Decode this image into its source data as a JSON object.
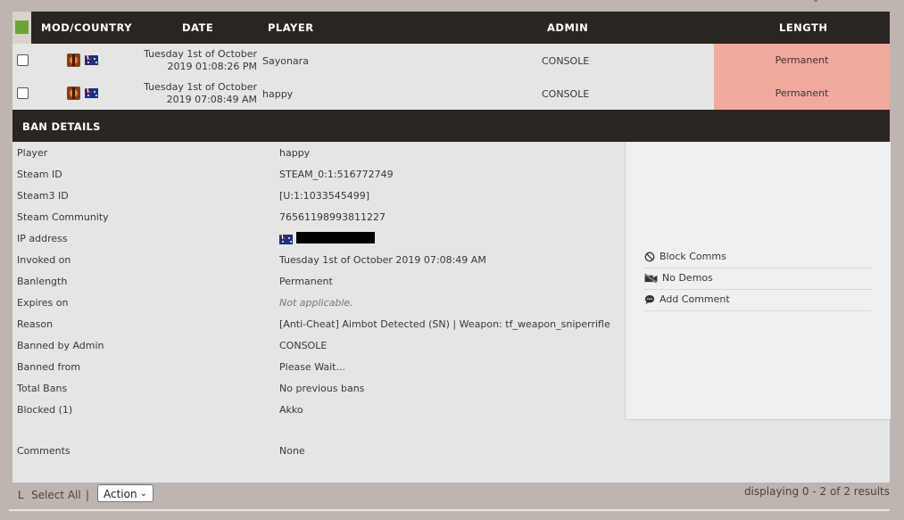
{
  "header": {
    "col_mod": "MOD/COUNTRY",
    "col_date": "DATE",
    "col_player": "PLAYER",
    "col_admin": "ADMIN",
    "col_length": "LENGTH"
  },
  "rows": [
    {
      "date_line1": "Tuesday 1st of October",
      "date_line2": "2019 01:08:26 PM",
      "player": "Sayonara",
      "admin": "CONSOLE",
      "length": "Permanent"
    },
    {
      "date_line1": "Tuesday 1st of October",
      "date_line2": "2019 07:08:49 AM",
      "player": "happy",
      "admin": "CONSOLE",
      "length": "Permanent"
    }
  ],
  "ban_details": {
    "title": "BAN DETAILS",
    "fields": [
      {
        "label": "Player",
        "value": "happy"
      },
      {
        "label": "Steam ID",
        "value": "STEAM_0:1:516772749"
      },
      {
        "label": "Steam3 ID",
        "value": "[U:1:1033545499]"
      },
      {
        "label": "Steam Community",
        "value": "76561198993811227"
      },
      {
        "label": "IP address",
        "value": ""
      },
      {
        "label": "Invoked on",
        "value": "Tuesday 1st of October 2019 07:08:49 AM"
      },
      {
        "label": "Banlength",
        "value": "Permanent"
      },
      {
        "label": "Expires on",
        "value": "Not applicable."
      },
      {
        "label": "Reason",
        "value": "[Anti-Cheat] Aimbot Detected (SN) | Weapon: tf_weapon_sniperrifle"
      },
      {
        "label": "Banned by Admin",
        "value": "CONSOLE"
      },
      {
        "label": "Banned from",
        "value": "Please Wait..."
      },
      {
        "label": "Total Bans",
        "value": "No previous bans"
      },
      {
        "label": "Blocked (1)",
        "value": "Akko"
      }
    ],
    "comments_label": "Comments",
    "comments_value": "None",
    "actions": [
      {
        "label": "Block Comms",
        "icon": "block-icon"
      },
      {
        "label": "No Demos",
        "icon": "no-video-icon"
      },
      {
        "label": "Add Comment",
        "icon": "comment-icon"
      }
    ]
  },
  "footer": {
    "select_all_prefix": "L",
    "select_all": "Select All",
    "separator": "|",
    "action_select": "Action",
    "displaying": "displaying 0 - 2 of 2 results"
  },
  "colors": {
    "header_bg": "#2a2521",
    "length_bg": "#f2a99e",
    "select_all_box": "#6aa43a"
  }
}
